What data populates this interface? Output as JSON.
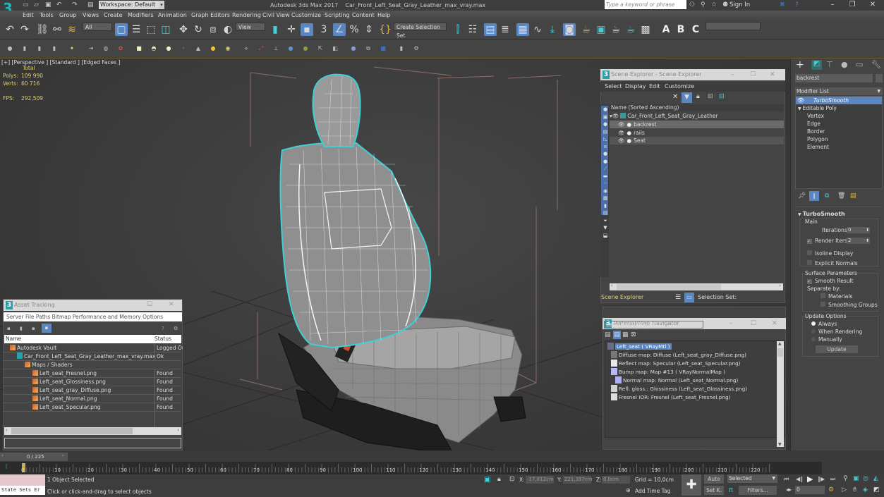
{
  "app": {
    "title": "Autodesk 3ds Max 2017",
    "filename": "Car_Front_Left_Seat_Gray_Leather_max_vray.max",
    "logo": "3",
    "workspace": "Workspace: Default",
    "search_placeholder": "Type a keyword or phrase",
    "sign_in": "Sign In"
  },
  "menu": [
    "Edit",
    "Tools",
    "Group",
    "Views",
    "Create",
    "Modifiers",
    "Animation",
    "Graph Editors",
    "Rendering",
    "Civil View",
    "Customize",
    "Scripting",
    "Content",
    "Help"
  ],
  "toolbar": {
    "selection_filter": "All",
    "ref_coord": "View",
    "selection_set": "Create Selection Set",
    "named_set_dropdown": ""
  },
  "viewport": {
    "label": "[+] [Perspective ] [Standard ] [Edged Faces ]",
    "stats_header": "Total",
    "polys_label": "Polys:",
    "polys": "109 990",
    "verts_label": "Verts:",
    "verts": "60 716",
    "fps_label": "FPS:",
    "fps": "292,509"
  },
  "asset_tracking": {
    "title": "Asset Tracking",
    "menu": "Server  File  Paths  Bitmap Performance and Memory  Options",
    "col_name": "Name",
    "col_status": "Status",
    "rows": [
      {
        "name": "Autodesk Vault",
        "status": "Logged Out"
      },
      {
        "name": "Car_Front_Left_Seat_Gray_Leather_max_vray.max",
        "status": "Ok"
      },
      {
        "name": "Maps / Shaders",
        "status": ""
      },
      {
        "name": "Left_seat_Fresnel.png",
        "status": "Found"
      },
      {
        "name": "Left_seat_Glossiness.png",
        "status": "Found"
      },
      {
        "name": "Left_seat_gray_Diffuse.png",
        "status": "Found"
      },
      {
        "name": "Left_seat_Normal.png",
        "status": "Found"
      },
      {
        "name": "Left_seat_Specular.png",
        "status": "Found"
      }
    ]
  },
  "scene_explorer": {
    "title": "Scene Explorer - Scene Explorer",
    "menu": [
      "Select",
      "Display",
      "Edit",
      "Customize"
    ],
    "col_header": "Name (Sorted Ascending)",
    "root": "Car_Front_Left_Seat_Gray_Leather",
    "children": [
      "backrest",
      "rails",
      "Seat"
    ],
    "footer_name": "Scene Explorer",
    "selection_set_label": "Selection Set:"
  },
  "material_navigator": {
    "title": "Material/Map Navigator",
    "current": "Left_seat  ( VRayMtl )",
    "root": "Left_seat  ( VRayMtl )",
    "maps": [
      {
        "label": "Diffuse map: Diffuse (Left_seat_gray_Diffuse.png)",
        "swatch": "#777777"
      },
      {
        "label": "Reflect map: Specular (Left_seat_Specular.png)",
        "swatch": "#e8e8e8"
      },
      {
        "label": "Bump map: Map #13  ( VRayNormalMap )",
        "swatch": "#b8b8f0"
      },
      {
        "label": "Normal map: Normal (Left_seat_Normal.png)",
        "swatch": "#b0b0f0"
      },
      {
        "label": "Refl. gloss.: Glossiness (Left_seat_Glossiness.png)",
        "swatch": "#d0d0d0"
      },
      {
        "label": "Fresnel IOR: Fresnel (Left_seat_Fresnel.png)",
        "swatch": "#dddddd"
      }
    ]
  },
  "command_panel": {
    "object_name": "backrest",
    "modifier_list": "Modifier List",
    "stack": [
      "TurboSmooth",
      "Editable Poly",
      "Vertex",
      "Edge",
      "Border",
      "Polygon",
      "Element"
    ],
    "turbosmooth": {
      "title": "TurboSmooth",
      "main": "Main",
      "iterations_label": "Iterations:",
      "iterations": "0",
      "render_iters_label": "Render Iters:",
      "render_iters": "2",
      "isoline": "Isoline Display",
      "explicit_normals": "Explicit Normals",
      "surface_params": "Surface Parameters",
      "smooth_result": "Smooth Result",
      "separate_by": "Separate by:",
      "materials": "Materials",
      "smoothing_groups": "Smoothing Groups",
      "update_options": "Update Options",
      "always": "Always",
      "when_rendering": "When Rendering",
      "manually": "Manually",
      "update_button": "Update"
    }
  },
  "timeline": {
    "frame": "0 / 225",
    "ticks": [
      "0",
      "10",
      "20",
      "30",
      "40",
      "50",
      "60",
      "70",
      "80",
      "90",
      "100",
      "110",
      "120",
      "130",
      "140",
      "150",
      "160",
      "170",
      "180",
      "190",
      "200",
      "210",
      "220"
    ]
  },
  "status": {
    "selected": "1 Object Selected",
    "prompt": "Click or click-and-drag to select objects",
    "state_sets": "State Sets Er",
    "x_label": "X:",
    "x": "-17,812cm",
    "y_label": "Y:",
    "y": "221,397cm",
    "z_label": "Z:",
    "z": "0,0cm",
    "grid": "Grid = 10,0cm",
    "add_time_tag": "Add Time Tag",
    "auto": "Auto",
    "set_key": "Set K.",
    "key_filter": "Selected",
    "filters": "Filters...",
    "current_frame": "0"
  },
  "colors": {
    "accent": "#5a86c2",
    "selection_outline": "#3fd0d6",
    "stats_text": "#e0d070"
  }
}
